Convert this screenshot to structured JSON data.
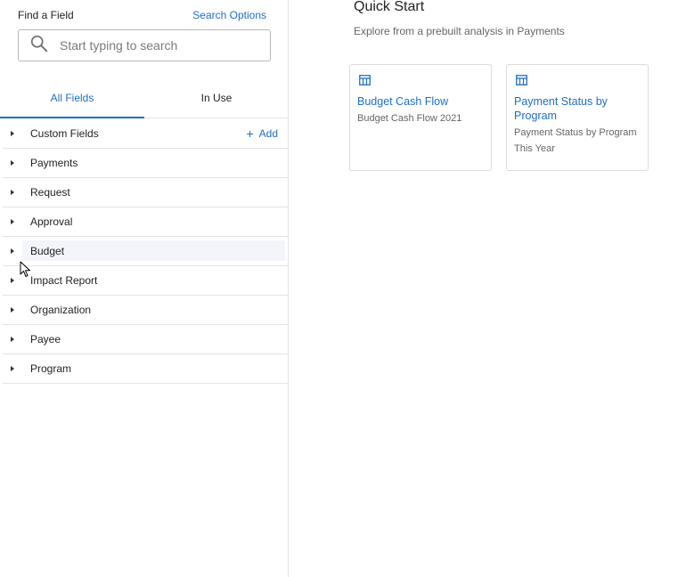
{
  "find": {
    "title": "Find a Field",
    "search_options": "Search Options",
    "search_placeholder": "Start typing to search"
  },
  "tabs": [
    {
      "label": "All Fields",
      "active": true
    },
    {
      "label": "In Use",
      "active": false
    }
  ],
  "fields": [
    {
      "label": "Custom Fields",
      "action": "Add"
    },
    {
      "label": "Payments"
    },
    {
      "label": "Request"
    },
    {
      "label": "Approval"
    },
    {
      "label": "Budget"
    },
    {
      "label": "Impact Report"
    },
    {
      "label": "Organization"
    },
    {
      "label": "Payee"
    },
    {
      "label": "Program"
    }
  ],
  "quick_start": {
    "title": "Quick Start",
    "subtitle": "Explore from a prebuilt analysis in Payments",
    "cards": [
      {
        "icon": "table-icon",
        "title": "Budget Cash Flow",
        "description": "Budget Cash Flow 2021"
      },
      {
        "icon": "table-icon",
        "title": "Payment Status by Program",
        "description": "Payment Status by Program This Year"
      }
    ]
  },
  "colors": {
    "accent": "#1f6fc5",
    "border": "#e4e4e4",
    "hover": "#f3f5fb"
  }
}
